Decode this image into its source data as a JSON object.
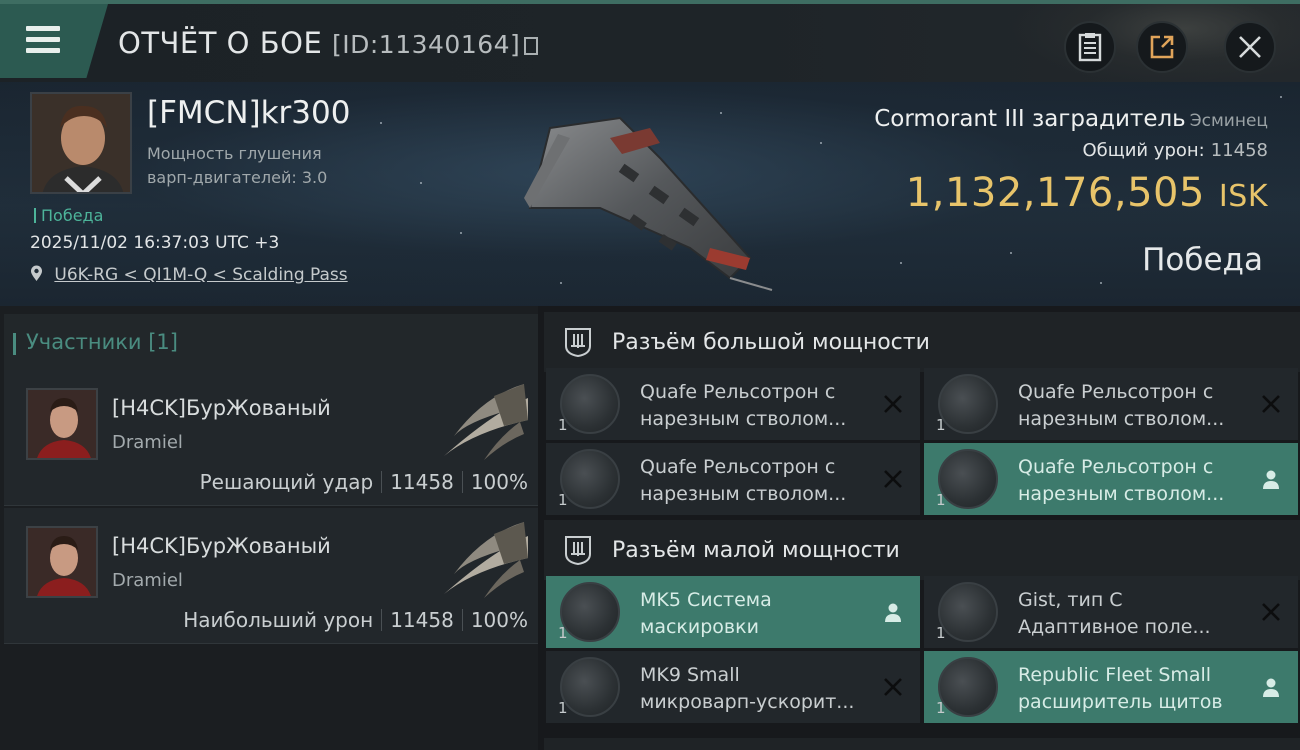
{
  "header": {
    "title": "ОТЧЁТ О БОЕ",
    "report_id": "[ID:11340164]"
  },
  "icons": {
    "menu": "hamburger-icon",
    "copy": "copy-icon",
    "clipboard": "clipboard-icon",
    "share": "share-icon",
    "close": "close-icon",
    "location": "location-pin-icon"
  },
  "victim": {
    "name": "[FMCN]kr300",
    "warp_line1": "Мощность глушения",
    "warp_line2": "варп-двигателей: 3.0",
    "status": "Победа",
    "datetime": "2025/11/02 16:37:03 UTC +3",
    "location": "U6K-RG < QI1M-Q < Scalding Pass"
  },
  "ship": {
    "name": "Cormorant III заградитель",
    "class": "Эсминец",
    "damage_label": "Общий урон:",
    "damage_value": "11458",
    "isk_value": "1,132,176,505",
    "isk_unit": "ISK",
    "result": "Победа"
  },
  "participants": {
    "label": "Участники [1]",
    "rows": [
      {
        "name": "[H4CK]БурЖованый",
        "ship": "Dramiel",
        "role": "Решающий удар",
        "damage": "11458",
        "percent": "100%"
      },
      {
        "name": "[H4CK]БурЖованый",
        "ship": "Dramiel",
        "role": "Наибольший урон",
        "damage": "11458",
        "percent": "100%"
      }
    ]
  },
  "fittings": {
    "high_title": "Разъём большой мощности",
    "low_title": "Разъём малой мощности",
    "high": [
      {
        "qty": "1",
        "line1": "Quafe Рельсотрон с",
        "line2": "нарезным стволом...",
        "state": "destroyed"
      },
      {
        "qty": "1",
        "line1": "Quafe Рельсотрон с",
        "line2": "нарезным стволом...",
        "state": "destroyed"
      },
      {
        "qty": "1",
        "line1": "Quafe Рельсотрон с",
        "line2": "нарезным стволом...",
        "state": "destroyed"
      },
      {
        "qty": "1",
        "line1": "Quafe Рельсотрон с",
        "line2": "нарезным стволом...",
        "state": "dropped"
      }
    ],
    "low": [
      {
        "qty": "1",
        "line1": "MK5 Система",
        "line2": "маскировки",
        "state": "dropped"
      },
      {
        "qty": "1",
        "line1": "Gist, тип C",
        "line2": "Адаптивное поле...",
        "state": "destroyed"
      },
      {
        "qty": "1",
        "line1": "MK9 Small",
        "line2": "микроварп-ускорит...",
        "state": "destroyed"
      },
      {
        "qty": "1",
        "line1": "Republic Fleet Small",
        "line2": "расширитель щитов",
        "state": "dropped"
      }
    ]
  },
  "colors": {
    "accent": "#3d7a6c",
    "isk": "#e8c46a",
    "victory": "#4db49a"
  }
}
